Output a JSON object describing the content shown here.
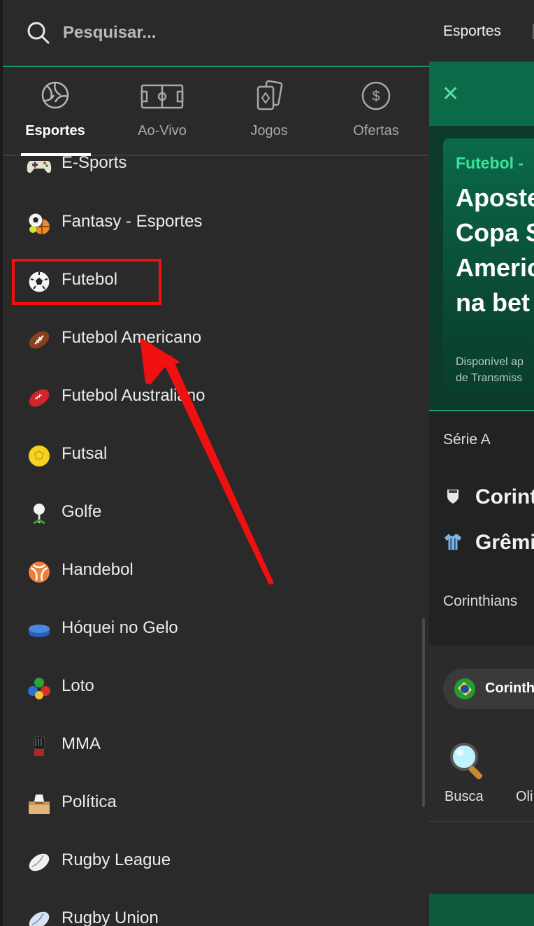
{
  "search": {
    "placeholder": "Pesquisar..."
  },
  "tabs": [
    {
      "label": "Esportes",
      "icon": "volleyball-icon",
      "active": true
    },
    {
      "label": "Ao-Vivo",
      "icon": "field-icon",
      "active": false
    },
    {
      "label": "Jogos",
      "icon": "cards-icon",
      "active": false
    },
    {
      "label": "Ofertas",
      "icon": "dollar-coin-icon",
      "active": false
    }
  ],
  "sports": [
    {
      "label": "E-Sports",
      "icon": "gamepad-icon"
    },
    {
      "label": "Fantasy - Esportes",
      "icon": "fantasy-balls-icon"
    },
    {
      "label": "Futebol",
      "icon": "soccer-ball-icon"
    },
    {
      "label": "Futebol Americano",
      "icon": "american-football-icon"
    },
    {
      "label": "Futebol Australiano",
      "icon": "australian-football-icon"
    },
    {
      "label": "Futsal",
      "icon": "futsal-ball-icon"
    },
    {
      "label": "Golfe",
      "icon": "golf-ball-icon"
    },
    {
      "label": "Handebol",
      "icon": "handball-icon"
    },
    {
      "label": "Hóquei no Gelo",
      "icon": "hockey-puck-icon"
    },
    {
      "label": "Loto",
      "icon": "lottery-balls-icon"
    },
    {
      "label": "MMA",
      "icon": "mma-glove-icon"
    },
    {
      "label": "Política",
      "icon": "ballot-box-icon"
    },
    {
      "label": "Rugby League",
      "icon": "rugby-ball-icon"
    },
    {
      "label": "Rugby Union",
      "icon": "rugby-union-ball-icon"
    }
  ],
  "background_page": {
    "tab": "Esportes",
    "promo": {
      "tag": "Futebol -",
      "lines": [
        "Aposte",
        "Copa S",
        "Americ",
        "na bet"
      ],
      "small": [
        "Disponível ap",
        "de Transmiss"
      ]
    },
    "league": "Série A",
    "teams": [
      "Corint",
      "Grêmi"
    ],
    "match": "Corinthians",
    "pill_label": "Corinth",
    "shortcuts": [
      "Busca",
      "Oli"
    ]
  },
  "colors": {
    "drawer_bg": "#2a2a2a",
    "accent_green": "#1b9b67",
    "annotation_red": "#f01010"
  }
}
